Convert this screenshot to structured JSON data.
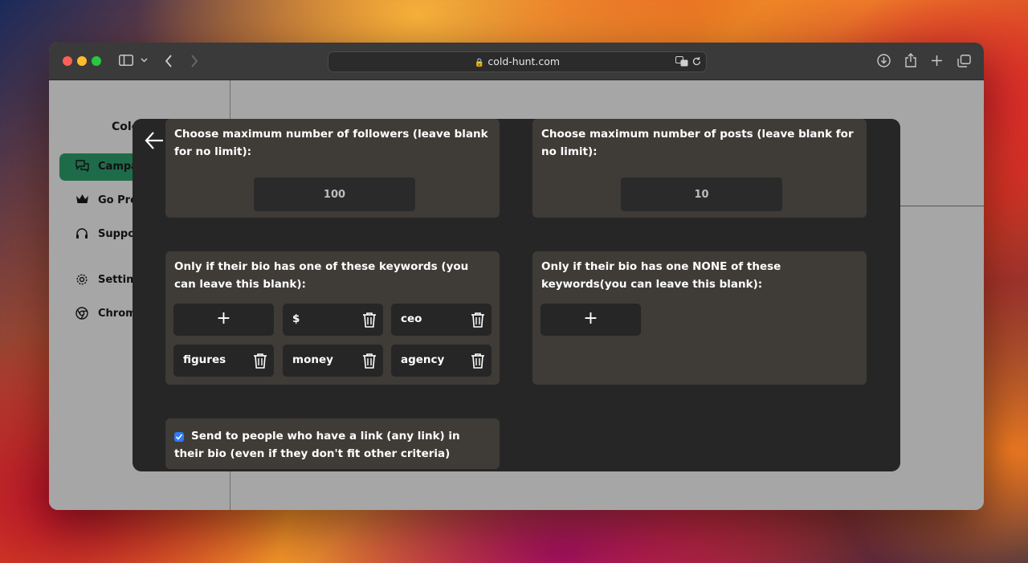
{
  "browser": {
    "url": "cold-hunt.com"
  },
  "sidebar": {
    "brand": "Colc",
    "items": [
      {
        "label": "Campa",
        "icon": "chat-bubbles-icon",
        "active": true
      },
      {
        "label": "Go Pro",
        "icon": "crown-icon"
      },
      {
        "label": "Suppor",
        "icon": "headset-icon"
      },
      {
        "label": "Setting",
        "icon": "gear-icon"
      },
      {
        "label": "Chrome",
        "icon": "chrome-icon"
      }
    ]
  },
  "modal": {
    "max_followers": {
      "title": "Choose maximum number of followers (leave blank for no limit):",
      "value": "100"
    },
    "max_posts": {
      "title": "Choose maximum number of posts (leave blank for no limit):",
      "value": "10"
    },
    "include_keywords": {
      "title": "Only if their bio has one of these keywords (you can leave this blank):",
      "add_label": "+",
      "keywords": [
        "$",
        "ceo",
        "figures",
        "money",
        "agency"
      ]
    },
    "exclude_keywords": {
      "title": "Only if their bio has one NONE of these keywords(you can leave this blank):",
      "add_label": "+"
    },
    "link_option": {
      "checked": true,
      "label": "Send to people who have a link (any link) in their bio (even if they don't fit other criteria)"
    }
  },
  "colors": {
    "accent": "#1e6b4a",
    "checkbox": "#2f7bf6",
    "modal_bg": "#262626",
    "card_bg": "#3f3c38"
  }
}
